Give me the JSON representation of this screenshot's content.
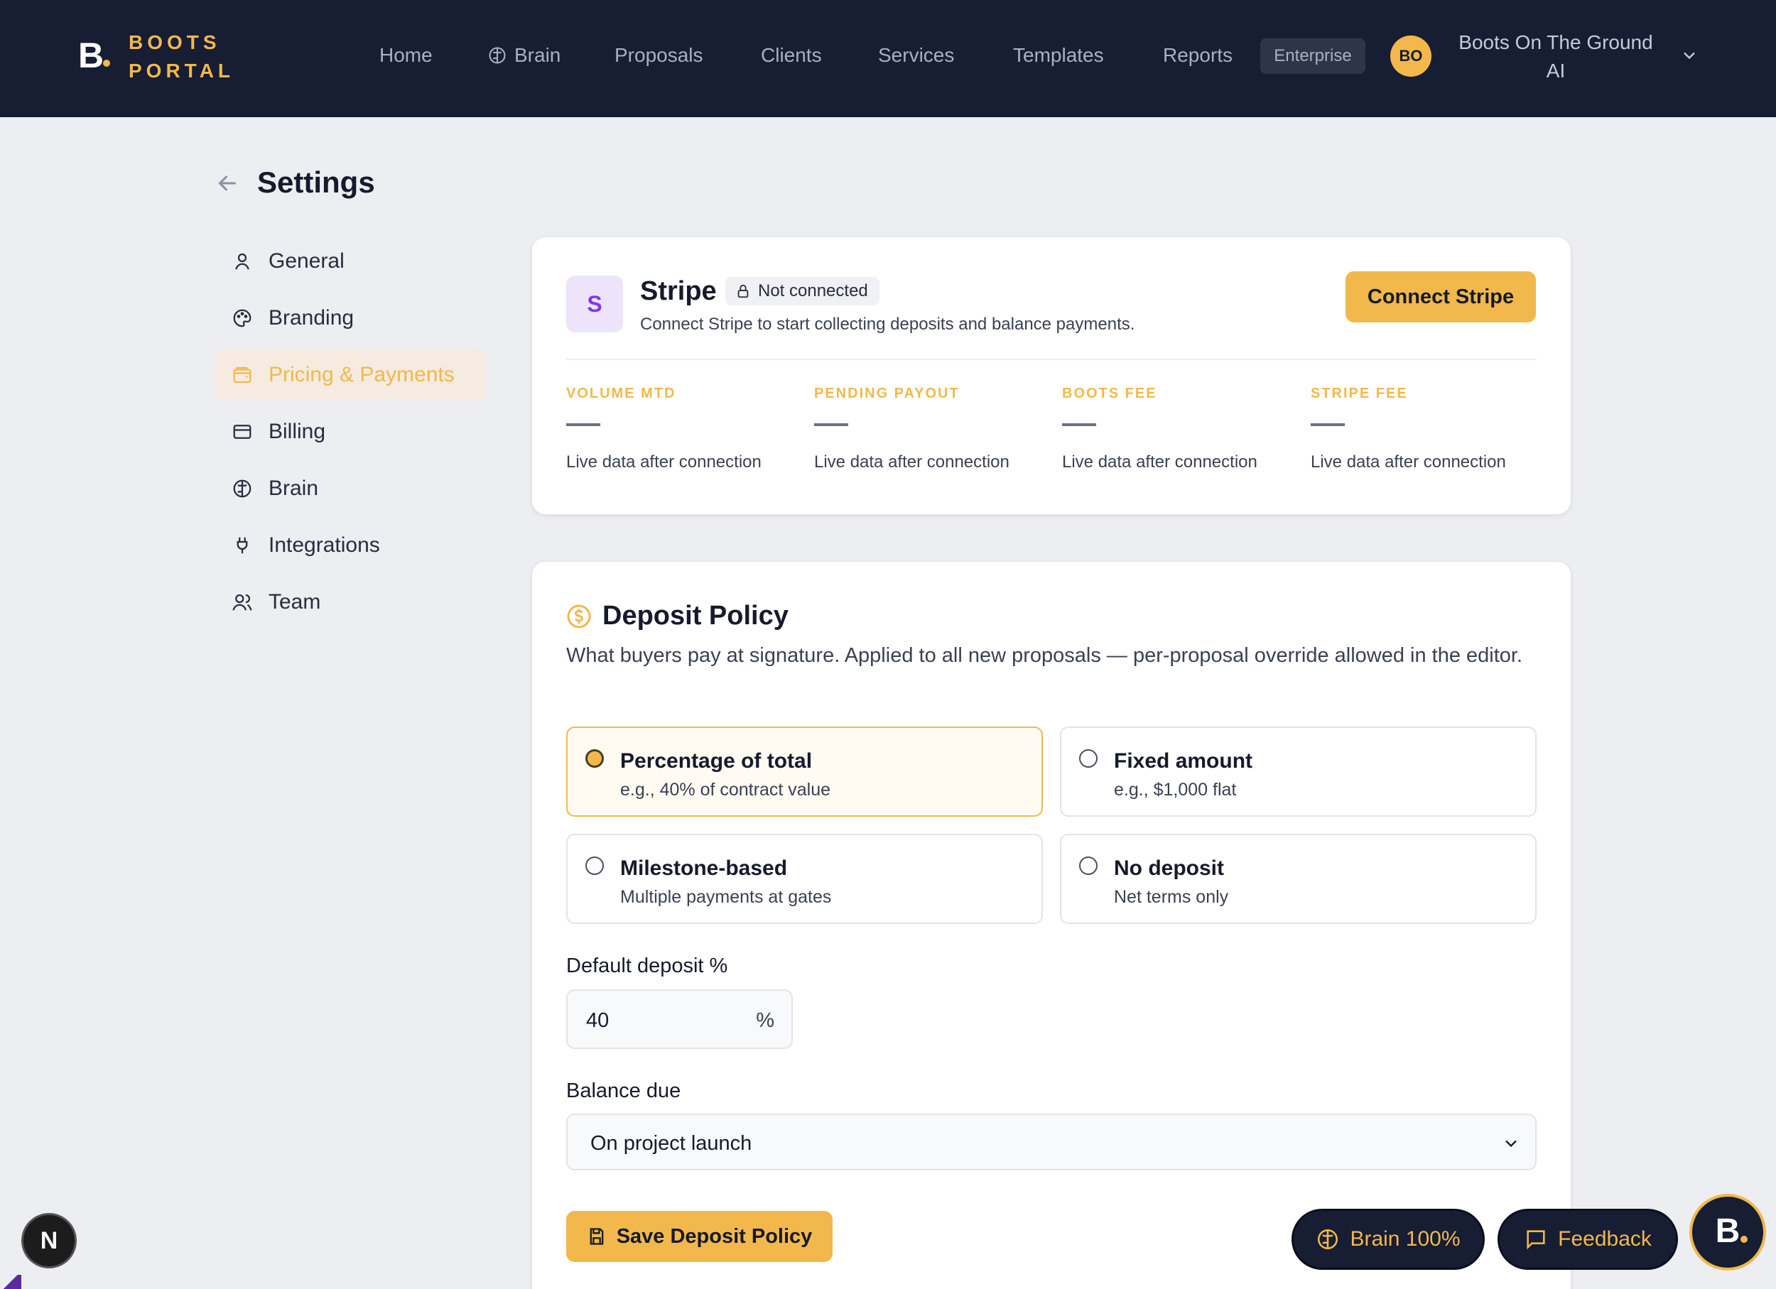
{
  "brand": {
    "mark": "B.",
    "line1": "BOOTS",
    "line2": "PORTAL",
    "accent": "#f2b84b",
    "navy": "#171d33"
  },
  "nav": {
    "items": [
      {
        "label": "Home"
      },
      {
        "label": "Brain",
        "icon": "brain-icon"
      },
      {
        "label": "Proposals"
      },
      {
        "label": "Clients"
      },
      {
        "label": "Services"
      },
      {
        "label": "Templates"
      },
      {
        "label": "Reports"
      }
    ],
    "plan_badge": "Enterprise",
    "avatar_initials": "BO",
    "account_name": "Boots On The Ground AI"
  },
  "settings": {
    "title": "Settings",
    "sidebar": [
      {
        "label": "General",
        "icon": "user-icon"
      },
      {
        "label": "Branding",
        "icon": "palette-icon"
      },
      {
        "label": "Pricing & Payments",
        "icon": "wallet-icon",
        "active": true
      },
      {
        "label": "Billing",
        "icon": "credit-card-icon"
      },
      {
        "label": "Brain",
        "icon": "brain-icon"
      },
      {
        "label": "Integrations",
        "icon": "plug-icon"
      },
      {
        "label": "Team",
        "icon": "users-icon"
      }
    ]
  },
  "stripe": {
    "logo_letter": "S",
    "name": "Stripe",
    "status": "Not connected",
    "description": "Connect Stripe to start collecting deposits and balance payments.",
    "connect_label": "Connect Stripe",
    "stats": [
      {
        "label": "VOLUME MTD",
        "value": "—",
        "sub": "Live data after connection"
      },
      {
        "label": "PENDING PAYOUT",
        "value": "—",
        "sub": "Live data after connection"
      },
      {
        "label": "BOOTS FEE",
        "value": "—",
        "sub": "Live data after connection"
      },
      {
        "label": "STRIPE FEE",
        "value": "—",
        "sub": "Live data after connection"
      }
    ]
  },
  "deposit": {
    "title": "Deposit Policy",
    "description": "What buyers pay at signature. Applied to all new proposals — per-proposal override allowed in the editor.",
    "options": [
      {
        "title": "Percentage of total",
        "sub": "e.g., 40% of contract value",
        "selected": true
      },
      {
        "title": "Fixed amount",
        "sub": "e.g., $1,000 flat",
        "selected": false
      },
      {
        "title": "Milestone-based",
        "sub": "Multiple payments at gates",
        "selected": false
      },
      {
        "title": "No deposit",
        "sub": "Net terms only",
        "selected": false
      }
    ],
    "default_label": "Default deposit %",
    "default_value": "40",
    "default_suffix": "%",
    "balance_label": "Balance due",
    "balance_value": "On project launch",
    "save_label": "Save Deposit Policy"
  },
  "floating": {
    "brain_label": "Brain 100%",
    "feedback_label": "Feedback",
    "b_mark": "B.",
    "n_mark": "N"
  }
}
